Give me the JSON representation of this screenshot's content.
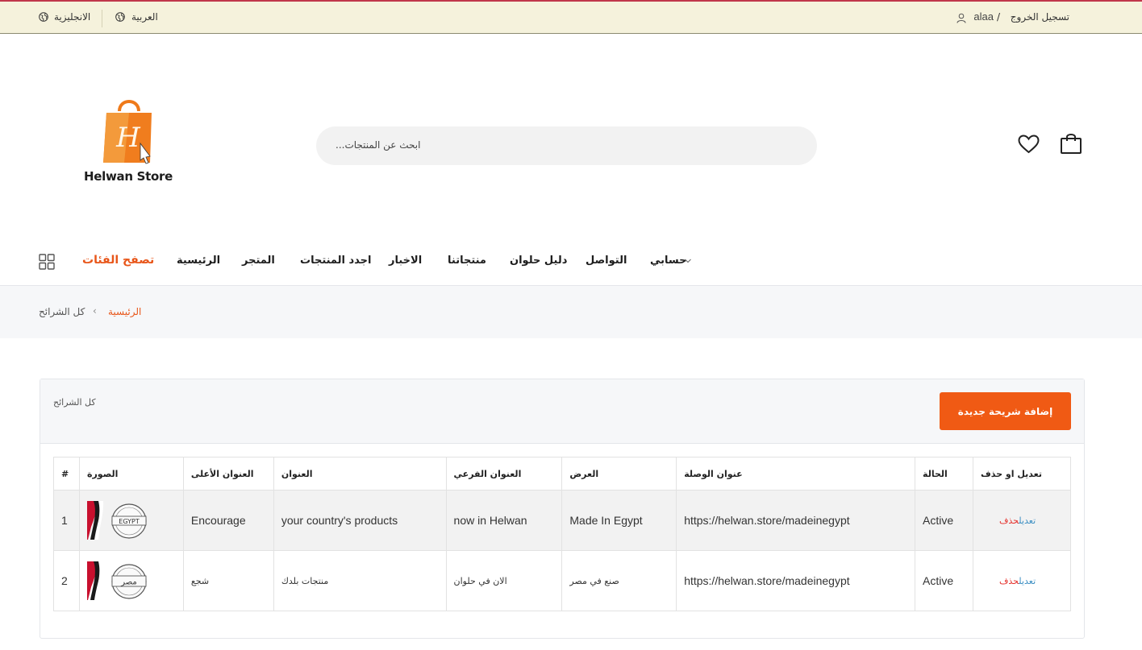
{
  "topbar": {
    "logout": "تسجيل الخروج",
    "slash": "/",
    "username": "alaa",
    "lang_ar": "العربية",
    "lang_en": "الانجليزية"
  },
  "header": {
    "brand": "Helwan Store",
    "search_placeholder": "...ابحث عن المنتجات"
  },
  "nav": {
    "browse": "تصفح الفئات",
    "items": [
      "الرئيسية",
      "المتجر",
      "اجدد المنتجات",
      "الاخبار",
      "منتجاتنا",
      "دليل حلوان",
      "التواصل",
      "حسابي"
    ]
  },
  "breadcrumb": {
    "home": "الرئيسية",
    "separator": "‹",
    "current": "كل الشرائح"
  },
  "card": {
    "title": "كل الشرائح",
    "add_button": "إضافة شريحة جديدة"
  },
  "table": {
    "headers": [
      "#",
      "الصورة",
      "العنوان الأعلى",
      "العنوان",
      "العنوان الفرعي",
      "العرض",
      "عنوان الوصلة",
      "الحالة",
      "تعديل او حذف"
    ],
    "rows": [
      {
        "num": "1",
        "top_title": "Encourage",
        "title": "your country's products",
        "subtitle": "now in Helwan",
        "offer": "Made In Egypt",
        "link": "https://helwan.store/madeinegypt",
        "status": "Active",
        "edit": "تعديل",
        "delete": "حذف",
        "logo_text": "EGYPT"
      },
      {
        "num": "2",
        "top_title": "شجع",
        "title": "منتجات بلدك",
        "subtitle": "الان في حلوان",
        "offer": "صنع في مصر",
        "link": "https://helwan.store/madeinegypt",
        "status": "Active",
        "edit": "تعديل",
        "delete": "حذف",
        "logo_text": "مصر"
      }
    ]
  },
  "colors": {
    "accent": "#f05a14",
    "topbar_bg": "#f5f2dc",
    "edit_link": "#3b8ec2",
    "delete_link": "#e5322d"
  }
}
